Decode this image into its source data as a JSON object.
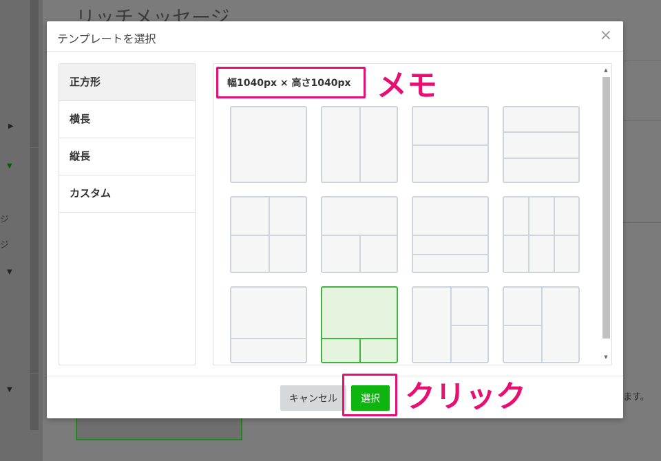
{
  "background": {
    "page_title": "リッチメッセージ",
    "side_text_1": "ジ",
    "side_text_2": "ジ",
    "right_text": "ます。"
  },
  "modal": {
    "title": "テンプレートを選択",
    "close_label": "×",
    "categories": [
      {
        "label": "正方形"
      },
      {
        "label": "横長"
      },
      {
        "label": "縦長"
      },
      {
        "label": "カスタム"
      }
    ],
    "size_label": "幅1040px × 高さ1040px",
    "cancel_label": "キャンセル",
    "select_label": "選択"
  },
  "annotations": {
    "memo": "メモ",
    "click": "クリック"
  },
  "colors": {
    "accent_pink": "#e60f72",
    "select_green": "#0fb50f",
    "selected_template_border": "#3db53d"
  }
}
